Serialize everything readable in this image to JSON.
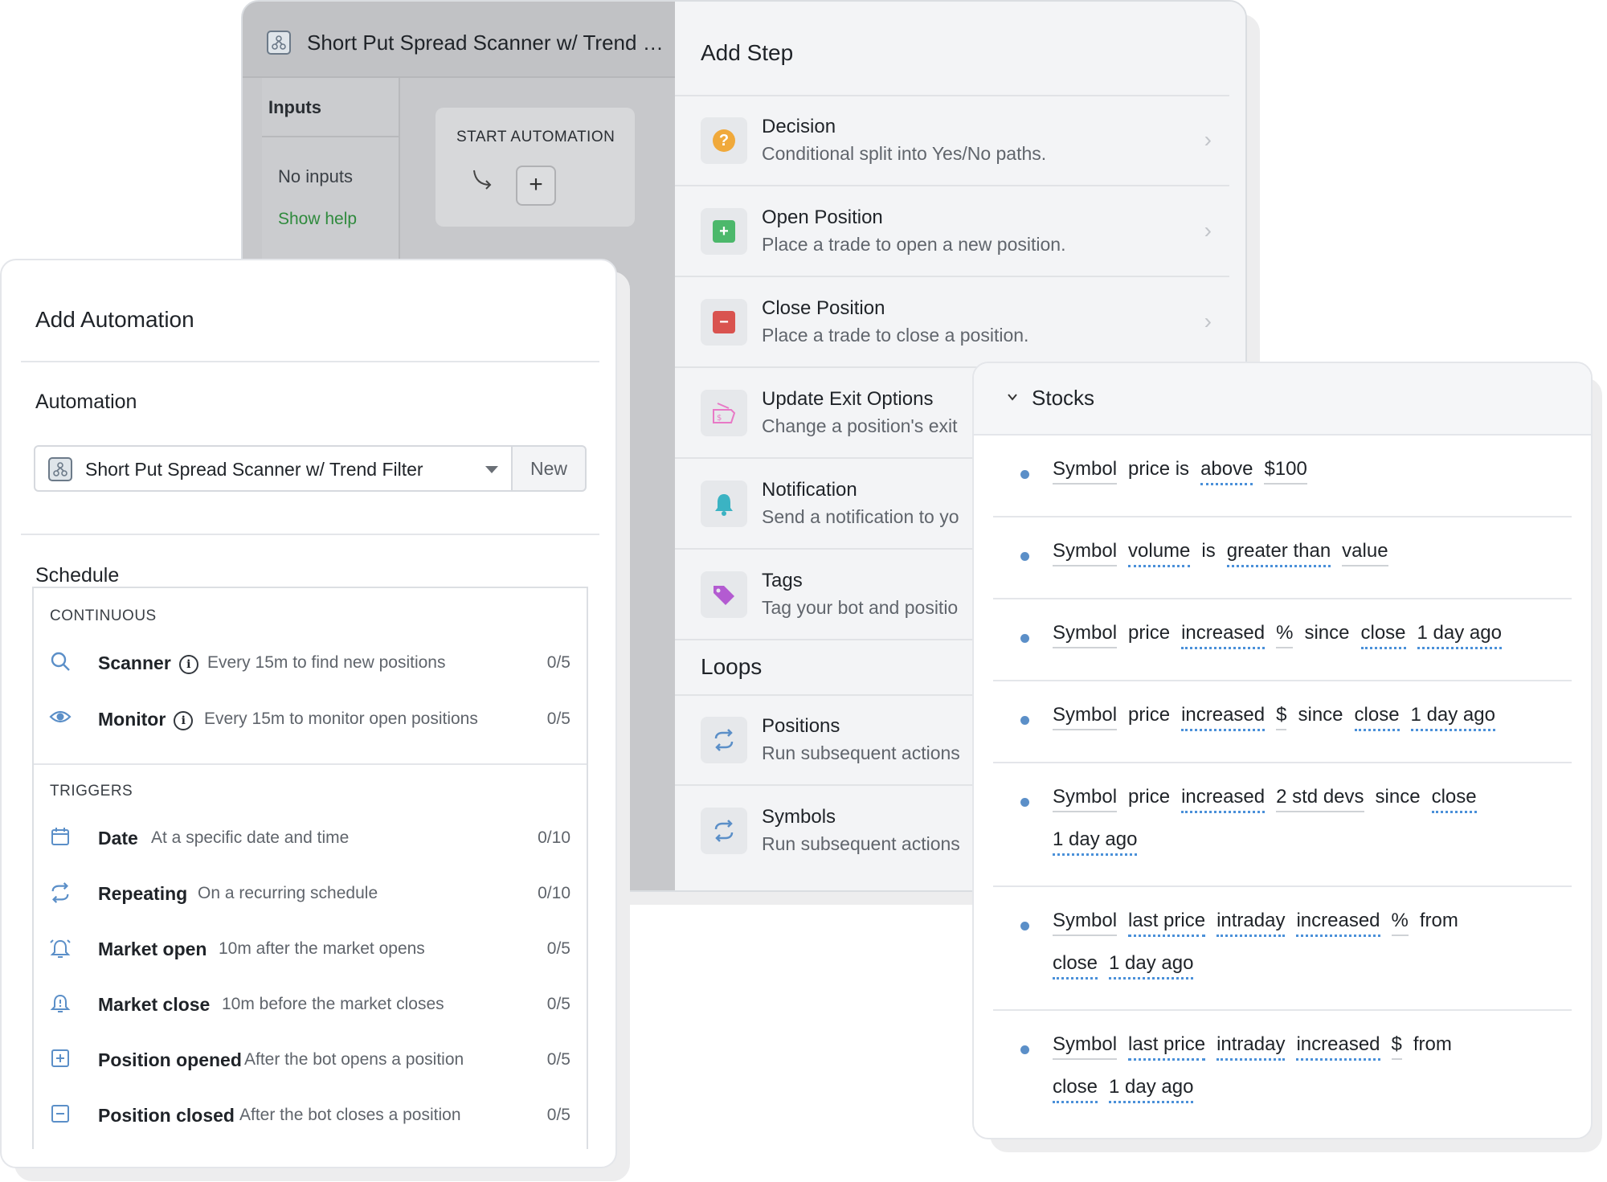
{
  "editor": {
    "title": "Short Put Spread Scanner w/ Trend Filter",
    "inputs_label": "Inputs",
    "no_inputs": "No inputs",
    "show_help": "Show help",
    "start_label": "START AUTOMATION",
    "start_plus": "+"
  },
  "add_step": {
    "title": "Add Step",
    "steps": [
      {
        "title": "Decision",
        "subtitle": "Conditional split into Yes/No paths."
      },
      {
        "title": "Open Position",
        "subtitle": "Place a trade to open a new position."
      },
      {
        "title": "Close Position",
        "subtitle": "Place a trade to close a position."
      },
      {
        "title": "Update Exit Options",
        "subtitle": "Change a position's exit"
      },
      {
        "title": "Notification",
        "subtitle": "Send a notification to yo"
      },
      {
        "title": "Tags",
        "subtitle": "Tag your bot and positio"
      }
    ],
    "loops_title": "Loops",
    "loops": [
      {
        "title": "Positions",
        "subtitle": "Run subsequent actions"
      },
      {
        "title": "Symbols",
        "subtitle": "Run subsequent actions"
      }
    ],
    "colors": {
      "decision": "#f0a93b",
      "open": "#4cb86b",
      "close": "#d9534f",
      "update": "#e879c6",
      "notification": "#3bb3c3",
      "tags": "#b35bd1",
      "loops": "#5b8fc8"
    }
  },
  "automation": {
    "title": "Add Automation",
    "automation_label": "Automation",
    "selected": "Short Put Spread Scanner w/ Trend Filter",
    "new_button": "New",
    "schedule_label": "Schedule",
    "continuous_label": "CONTINUOUS",
    "continuous": [
      {
        "icon": "search-icon",
        "name": "Scanner",
        "desc": "Every 15m to find new positions",
        "count": "0/5"
      },
      {
        "icon": "eye-icon",
        "name": "Monitor",
        "desc": "Every 15m to monitor open positions",
        "count": "0/5"
      }
    ],
    "triggers_label": "TRIGGERS",
    "triggers": [
      {
        "icon": "calendar-icon",
        "name": "Date",
        "desc": "At a specific date and time",
        "count": "0/10"
      },
      {
        "icon": "repeat-icon",
        "name": "Repeating",
        "desc": "On a recurring schedule",
        "count": "0/10"
      },
      {
        "icon": "alarm-icon",
        "name": "Market open",
        "desc": "10m after the market opens",
        "count": "0/5"
      },
      {
        "icon": "bell-alert-icon",
        "name": "Market close",
        "desc": "10m before the market closes",
        "count": "0/5"
      },
      {
        "icon": "plus-square-icon",
        "name": "Position opened",
        "desc": "After the bot opens a position",
        "count": "0/5"
      },
      {
        "icon": "minus-square-icon",
        "name": "Position closed",
        "desc": "After the bot closes a position",
        "count": "0/5"
      }
    ]
  },
  "stocks": {
    "title": "Stocks",
    "conditions": [
      [
        [
          "Symbol",
          "solid"
        ],
        [
          "price is",
          "plain"
        ],
        [
          "above",
          "blue"
        ],
        [
          "$100",
          "solid"
        ]
      ],
      [
        [
          "Symbol",
          "solid"
        ],
        [
          "volume",
          "blue"
        ],
        [
          "is",
          "plain"
        ],
        [
          "greater than",
          "blue"
        ],
        [
          "value",
          "solid"
        ]
      ],
      [
        [
          "Symbol",
          "solid"
        ],
        [
          "price",
          "plain"
        ],
        [
          "increased",
          "blue"
        ],
        [
          "%",
          "solid"
        ],
        [
          "since",
          "plain"
        ],
        [
          "close",
          "blue"
        ],
        [
          "1 day ago",
          "blue"
        ]
      ],
      [
        [
          "Symbol",
          "solid"
        ],
        [
          "price",
          "plain"
        ],
        [
          "increased",
          "blue"
        ],
        [
          "$",
          "solid"
        ],
        [
          "since",
          "plain"
        ],
        [
          "close",
          "blue"
        ],
        [
          "1 day ago",
          "blue"
        ]
      ],
      [
        [
          "Symbol",
          "solid"
        ],
        [
          "price",
          "plain"
        ],
        [
          "increased",
          "blue"
        ],
        [
          "2 std devs",
          "solid"
        ],
        [
          "since",
          "plain"
        ],
        [
          "close",
          "blue"
        ],
        [
          "1 day ago",
          "blue"
        ]
      ],
      [
        [
          "Symbol",
          "solid"
        ],
        [
          "last price",
          "blue"
        ],
        [
          "intraday",
          "blue"
        ],
        [
          "increased",
          "blue"
        ],
        [
          "%",
          "solid"
        ],
        [
          "from",
          "plain"
        ],
        [
          "close",
          "blue"
        ],
        [
          "1 day ago",
          "blue"
        ]
      ],
      [
        [
          "Symbol",
          "solid"
        ],
        [
          "last price",
          "blue"
        ],
        [
          "intraday",
          "blue"
        ],
        [
          "increased",
          "blue"
        ],
        [
          "$",
          "solid"
        ],
        [
          "from",
          "plain"
        ],
        [
          "close",
          "blue"
        ],
        [
          "1 day ago",
          "blue"
        ]
      ]
    ]
  }
}
